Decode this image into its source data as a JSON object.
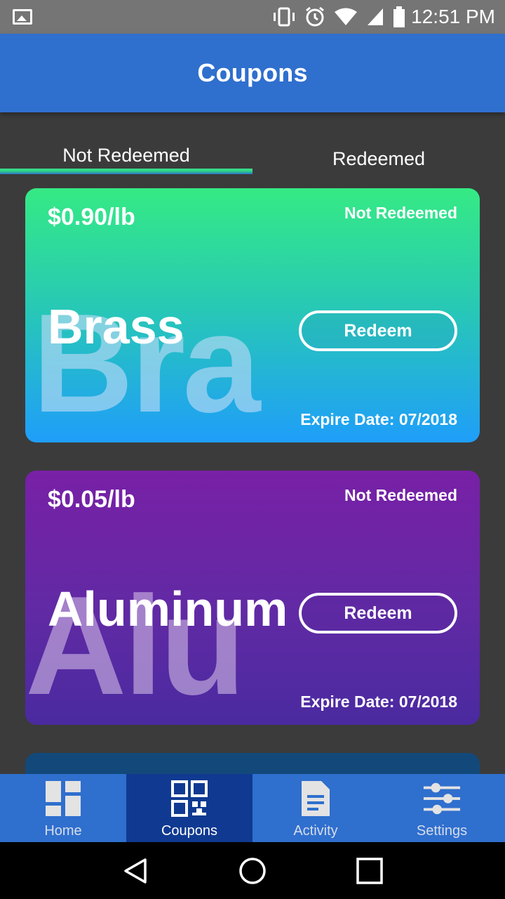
{
  "statusbar": {
    "time": "12:51 PM",
    "icons": [
      "image-notification-icon",
      "vibrate-icon",
      "alarm-icon",
      "wifi-icon",
      "signal-icon",
      "battery-icon"
    ]
  },
  "appbar": {
    "title": "Coupons"
  },
  "tabs": [
    {
      "label": "Not Redeemed",
      "active": true
    },
    {
      "label": "Redeemed",
      "active": false
    }
  ],
  "colors": {
    "primary": "#2f6fce",
    "nav_active": "#103a91",
    "tab_indicator": "#37e08a",
    "background": "#3b3b3b"
  },
  "coupons": [
    {
      "price": "$0.90/lb",
      "status": "Not Redeemed",
      "name": "Brass",
      "watermark": "Bra",
      "button": "Redeem",
      "expire": "Expire Date: 07/2018"
    },
    {
      "price": "$0.05/lb",
      "status": "Not Redeemed",
      "name": "Aluminum",
      "watermark": "Alu",
      "button": "Redeem",
      "expire": "Expire Date: 07/2018"
    }
  ],
  "bottomnav": [
    {
      "label": "Home",
      "icon": "dashboard-icon",
      "active": false
    },
    {
      "label": "Coupons",
      "icon": "qr-code-icon",
      "active": true
    },
    {
      "label": "Activity",
      "icon": "document-icon",
      "active": false
    },
    {
      "label": "Settings",
      "icon": "sliders-icon",
      "active": false
    }
  ],
  "sysnav": [
    "back-icon",
    "home-circle-icon",
    "recents-icon"
  ]
}
